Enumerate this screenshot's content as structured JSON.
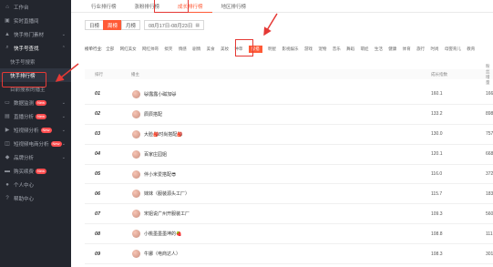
{
  "sidebar": {
    "items": [
      {
        "label": "工作台",
        "icon": "home-icon"
      },
      {
        "label": "实时直播间",
        "icon": "live-icon"
      },
      {
        "label": "快手热门素材",
        "icon": "fire-icon",
        "arrow": "⌄"
      },
      {
        "label": "快手号查找",
        "icon": "search-icon",
        "arrow": "⌃",
        "group": true
      },
      {
        "label": "快手号搜索",
        "sub": true
      },
      {
        "label": "快手排行榜",
        "sub": true,
        "active": true
      },
      {
        "label": "目前搜索的播主",
        "sub": true
      },
      {
        "label": "数据监测",
        "icon": "monitor-icon",
        "badge": "New",
        "arrow": "⌄"
      },
      {
        "label": "直播分析",
        "icon": "chart-icon",
        "badge": "New",
        "arrow": "⌄"
      },
      {
        "label": "短视频分析",
        "icon": "video-icon",
        "badge": "New",
        "arrow": "⌄"
      },
      {
        "label": "短视频电商分析",
        "icon": "cart-icon",
        "badge": "New",
        "arrow": "⌄"
      },
      {
        "label": "品牌分析",
        "icon": "diamond-icon",
        "arrow": "⌄"
      },
      {
        "label": "购买续费",
        "icon": "card-icon",
        "badge": "New"
      },
      {
        "label": "个人中心",
        "icon": "user-icon"
      },
      {
        "label": "帮助中心",
        "icon": "help-icon"
      }
    ]
  },
  "tabs": [
    "行业排行榜",
    "涨粉排行榜",
    "成长排行榜",
    "地区排行榜"
  ],
  "active_tab": 2,
  "period": {
    "day": "日榜",
    "week": "周榜",
    "month": "月榜",
    "active": "周榜",
    "date_range": "08月17日-08月23日"
  },
  "categories": {
    "label": "榜单行业:",
    "items": [
      "全部",
      "网红美女",
      "网红帅哥",
      "搞笑",
      "情感",
      "剧情",
      "美食",
      "美妆",
      "种草",
      "穿搭",
      "明星",
      "影视娱乐",
      "游戏",
      "宠物",
      "音乐",
      "舞蹈",
      "萌娃",
      "生活",
      "健康",
      "体育",
      "旅行",
      "时尚",
      "母婴育儿",
      "教育"
    ],
    "active": "穿搭"
  },
  "table": {
    "headers": {
      "rank": "排行",
      "name": "播主",
      "score": "成长指数",
      "more": "粉丝增量"
    },
    "rows": [
      {
        "rank": "01",
        "name": "😺露露小磁加😺",
        "score": "160.1",
        "more": "166"
      },
      {
        "rank": "02",
        "name": "辰辰搭配",
        "score": "133.2",
        "more": "898"
      },
      {
        "rank": "03",
        "name": "大脸🎒时尚搭配🎒",
        "score": "130.0",
        "more": "757"
      },
      {
        "rank": "04",
        "name": "百家庄园姐",
        "score": "120.1",
        "more": "668"
      },
      {
        "rank": "05",
        "name": "伴小米爱搭配😎",
        "score": "116.0",
        "more": "372"
      },
      {
        "rank": "06",
        "name": "妹妹（服装源头工厂）",
        "score": "115.7",
        "more": "183"
      },
      {
        "rank": "07",
        "name": "宋姐说广州开服装工厂",
        "score": "109.3",
        "more": "560"
      },
      {
        "rank": "08",
        "name": "小桃墨墨墨坤的🍓",
        "score": "108.8",
        "more": "111"
      },
      {
        "rank": "09",
        "name": "牛娜（电商达人）",
        "score": "108.3",
        "more": "301"
      }
    ]
  }
}
